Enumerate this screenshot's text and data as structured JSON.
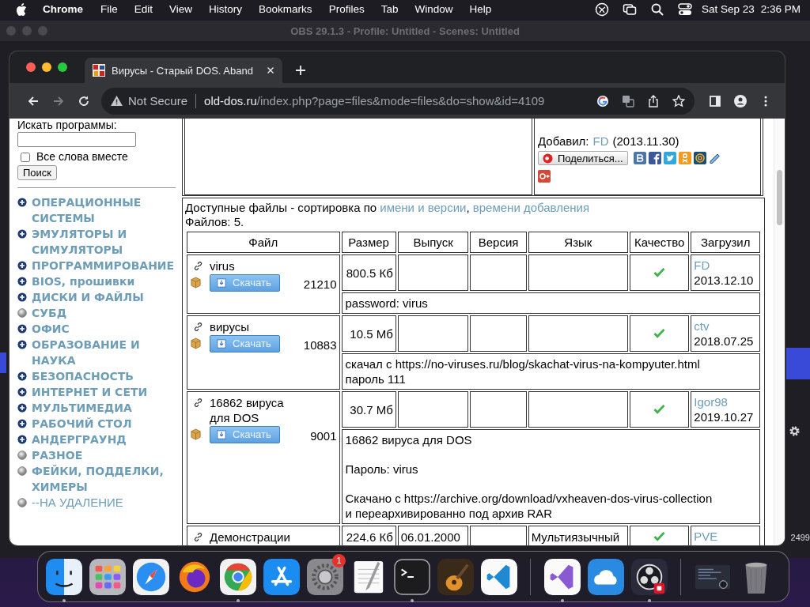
{
  "menu_bar": {
    "app": "Chrome",
    "menus": [
      "File",
      "Edit",
      "View",
      "History",
      "Bookmarks",
      "Profiles",
      "Tab",
      "Window",
      "Help"
    ],
    "date": "Sat Sep 23",
    "time": "2:36 PM"
  },
  "background_window": {
    "title": "OBS 29.1.3 - Profile: Untitled - Scenes: Untitled",
    "edge_text": "2499"
  },
  "browser": {
    "tabs": [
      {
        "title": "Вирусы - Старый DOS. Aband",
        "selected": true
      }
    ],
    "forward_disabled": true,
    "security": "Not Secure",
    "url_host": "old-dos.ru",
    "url_path": "/index.php?page=files&mode=files&do=show&id=4109"
  },
  "sidebar": {
    "search_label": "Искать программы:",
    "all_words": {
      "label": "Все слова вместе",
      "checked": false
    },
    "search_button": "Поиск",
    "categories": [
      {
        "label": "ОПЕРАЦИОННЫЕ СИСТЕМЫ",
        "kind": "folder"
      },
      {
        "label": "ЭМУЛЯТОРЫ И СИМУЛЯТОРЫ",
        "kind": "folder"
      },
      {
        "label": "ПРОГРАММИРОВАНИЕ",
        "kind": "folder"
      },
      {
        "label": "BIOS, прошивки",
        "kind": "folder"
      },
      {
        "label": "ДИСКИ И ФАЙЛЫ",
        "kind": "folder"
      },
      {
        "label": "СУБД",
        "kind": "leaf"
      },
      {
        "label": "ОФИС",
        "kind": "folder"
      },
      {
        "label": "ОБРАЗОВАНИЕ И НАУКА",
        "kind": "folder"
      },
      {
        "label": "БЕЗОПАСНОСТЬ",
        "kind": "folder"
      },
      {
        "label": "ИНТЕРНЕТ И СЕТИ",
        "kind": "folder"
      },
      {
        "label": "МУЛЬТИМЕДИА",
        "kind": "folder"
      },
      {
        "label": "РАБОЧИЙ СТОЛ",
        "kind": "folder"
      },
      {
        "label": "АНДЕРГРАУНД",
        "kind": "folder"
      },
      {
        "label": "РАЗНОЕ",
        "kind": "leaf"
      },
      {
        "label": "ФЕЙКИ, ПОДДЕЛКИ, ХИМЕРЫ",
        "kind": "leaf"
      },
      {
        "label": "--НА УДАЛЕНИЕ",
        "kind": "removed"
      }
    ]
  },
  "added": {
    "label": "Добавил:",
    "user": "FD",
    "date": "(2013.11.30)",
    "share_button": "Поделиться..."
  },
  "files": {
    "intro": "Доступные файлы - сортировка по",
    "sort_links": [
      "имени и версии",
      "времени добавления"
    ],
    "sort_separator": ",",
    "count": "Файлов: 5.",
    "columns": [
      "Файл",
      "Размер",
      "Выпуск",
      "Версия",
      "Язык",
      "Качество",
      "Загрузил"
    ],
    "rows": [
      {
        "name": "virus",
        "download_button": "Скачать",
        "downloads": "21210",
        "size": "800.5 Кб",
        "quality_ok": true,
        "uploader": "FD",
        "date": "2013.12.10",
        "description": [
          [
            "password: virus"
          ]
        ]
      },
      {
        "name": "вирусы",
        "download_button": "Скачать",
        "downloads": "10883",
        "size": "10.5 Мб",
        "quality_ok": true,
        "uploader": "ctv",
        "date": "2018.07.25",
        "description": [
          [
            "скачал с https://no-viruses.ru/blog/skachat-virus-na-kompyuter.html",
            "пароль 111"
          ]
        ]
      },
      {
        "name": "16862 вируса для DOS",
        "download_button": "Скачать",
        "downloads": "9001",
        "size": "30.7 Мб",
        "quality_ok": true,
        "uploader": "Igor98",
        "date": "2019.10.27",
        "description": [
          [
            "16862 вируса для DOS"
          ],
          [
            "Пароль: virus"
          ],
          [
            "Скачано с https://archive.org/download/vxheaven-dos-virus-collection",
            "и переархивированно под архив RAR"
          ]
        ]
      },
      {
        "name": "Демонстрации",
        "size": "224.6 Кб",
        "release": "06.01.2000",
        "language": "Мультиязычный",
        "quality_ok": true,
        "uploader": "PVE"
      }
    ]
  },
  "dock": {
    "apps": [
      {
        "kind": "finder",
        "running": true
      },
      {
        "kind": "launchpad",
        "running": false
      },
      {
        "kind": "safari",
        "running": false
      },
      {
        "kind": "firefox",
        "running": false
      },
      {
        "kind": "chrome",
        "running": true
      },
      {
        "kind": "appstore",
        "running": false
      },
      {
        "kind": "settings",
        "running": false,
        "badge": "1"
      },
      {
        "kind": "textedit",
        "running": false
      },
      {
        "kind": "terminal",
        "running": true
      },
      {
        "kind": "garageband",
        "running": false
      },
      {
        "kind": "vscode",
        "running": false
      }
    ],
    "recent": [
      {
        "kind": "visualstudio",
        "running": true
      },
      {
        "kind": "weather",
        "running": false
      },
      {
        "kind": "obs",
        "running": true
      }
    ],
    "stacks": [
      {
        "kind": "window",
        "running": false
      },
      {
        "kind": "trash",
        "running": false
      }
    ]
  }
}
